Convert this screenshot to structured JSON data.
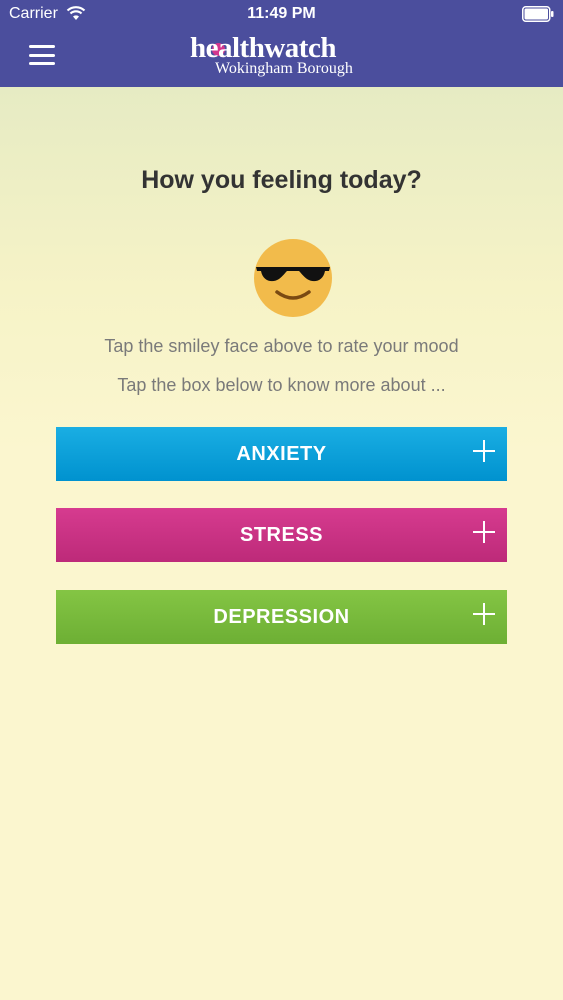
{
  "status_bar": {
    "carrier": "Carrier",
    "time": "11:49 PM"
  },
  "header": {
    "logo_main": "healthwatch",
    "logo_sub": "Wokingham Borough",
    "menu_icon": "hamburger-menu-icon",
    "background_color": "#4b4e9d"
  },
  "main": {
    "title": "How you feeling today?",
    "mood_icon": "cool-sunglasses-smiley-icon",
    "hint_1": "Tap the smiley face above to rate your mood",
    "hint_2": "Tap the box below to know more about ...",
    "topics": [
      {
        "label": "ANXIETY",
        "color": "#0ea3dc",
        "icon": "plus-icon"
      },
      {
        "label": "STRESS",
        "color": "#cc3385",
        "icon": "plus-icon"
      },
      {
        "label": "DEPRESSION",
        "color": "#78bb3c",
        "icon": "plus-icon"
      }
    ]
  }
}
